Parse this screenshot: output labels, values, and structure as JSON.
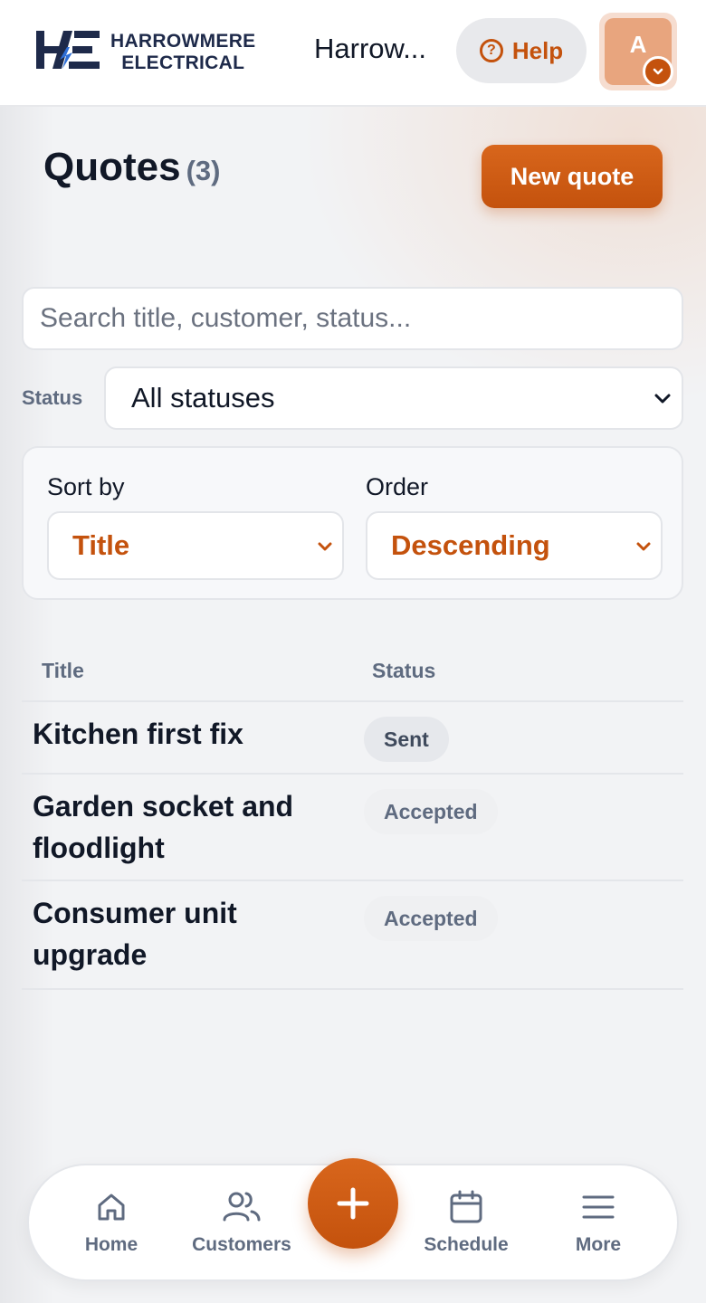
{
  "header": {
    "logo": {
      "line1": "HARROWMERE",
      "line2": "ELECTRICAL"
    },
    "org_name": "Harrow...",
    "help_label": "Help",
    "avatar_initial": "A"
  },
  "page": {
    "title": "Quotes",
    "count": "(3)",
    "new_quote_label": "New quote"
  },
  "filters": {
    "search_placeholder": "Search title, customer, status...",
    "status_label": "Status",
    "status_value": "All statuses",
    "sort_by_label": "Sort by",
    "sort_by_value": "Title",
    "order_label": "Order",
    "order_value": "Descending"
  },
  "table": {
    "headers": {
      "title": "Title",
      "status": "Status"
    },
    "rows": [
      {
        "title": "Kitchen first fix",
        "status": "Sent"
      },
      {
        "title": "Garden socket and floodlight",
        "status": "Accepted"
      },
      {
        "title": "Consumer unit upgrade",
        "status": "Accepted"
      }
    ]
  },
  "bottom_nav": {
    "items": [
      {
        "label": "Home",
        "icon": "home-icon"
      },
      {
        "label": "Customers",
        "icon": "users-icon"
      },
      {
        "label": "Schedule",
        "icon": "calendar-icon"
      },
      {
        "label": "More",
        "icon": "menu-icon"
      }
    ],
    "fab_icon": "plus-icon"
  },
  "colors": {
    "accent": "#c4520d",
    "logo_navy": "#1e2a4a",
    "muted": "#5f6b80"
  }
}
